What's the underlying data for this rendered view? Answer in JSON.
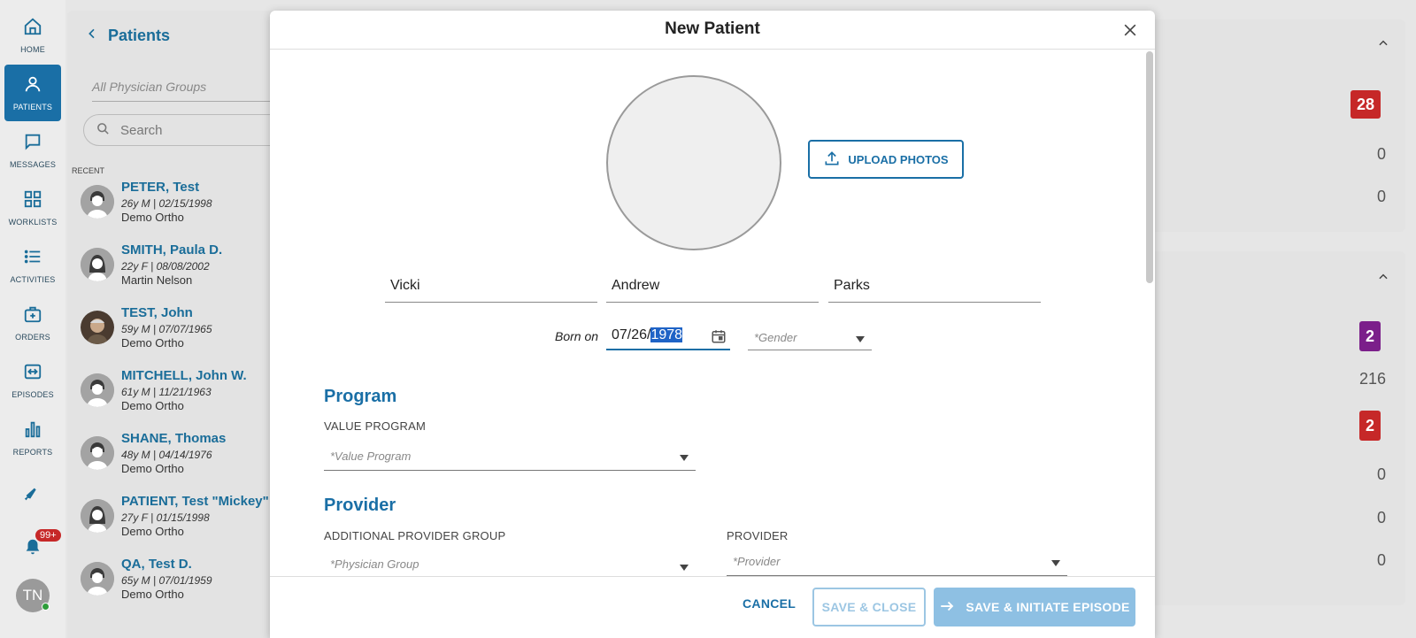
{
  "nav": {
    "items": [
      {
        "label": "HOME",
        "icon": "home-icon"
      },
      {
        "label": "PATIENTS",
        "icon": "person-icon"
      },
      {
        "label": "MESSAGES",
        "icon": "chat-icon"
      },
      {
        "label": "WORKLISTS",
        "icon": "grid-icon"
      },
      {
        "label": "ACTIVITIES",
        "icon": "list-icon"
      },
      {
        "label": "ORDERS",
        "icon": "medical-bag-icon"
      },
      {
        "label": "EPISODES",
        "icon": "episodes-icon"
      },
      {
        "label": "REPORTS",
        "icon": "bar-chart-icon"
      }
    ],
    "notifications_count": "99+",
    "user_initials": "TN"
  },
  "patients": {
    "title": "Patients",
    "filter_placeholder": "All Physician Groups",
    "search_placeholder": "Search",
    "recent_label": "RECENT",
    "list": [
      {
        "name": "PETER, Test",
        "meta": "26y M | 02/15/1998",
        "org": "Demo Ortho",
        "avatar": "male"
      },
      {
        "name": "SMITH, Paula D.",
        "meta": "22y F | 08/08/2002",
        "org": "Martin Nelson",
        "avatar": "female"
      },
      {
        "name": "TEST, John",
        "meta": "59y M | 07/07/1965",
        "org": "Demo Ortho",
        "avatar": "photo"
      },
      {
        "name": "MITCHELL, John W.",
        "meta": "61y M | 11/21/1963",
        "org": "Demo Ortho",
        "avatar": "male"
      },
      {
        "name": "SHANE, Thomas",
        "meta": "48y M | 04/14/1976",
        "org": "Demo Ortho",
        "avatar": "male"
      },
      {
        "name": "PATIENT, Test \"Mickey\"",
        "meta": "27y F | 01/15/1998",
        "org": "Demo Ortho",
        "avatar": "female"
      },
      {
        "name": "QA, Test D.",
        "meta": "65y M | 07/01/1959",
        "org": "Demo Ortho",
        "avatar": "male"
      }
    ]
  },
  "right_panel": {
    "card1_values": [
      "28",
      "0",
      "0"
    ],
    "card2_values": [
      "2",
      "216",
      "2",
      "0",
      "0",
      "0"
    ],
    "colors": {
      "red": "#c62828",
      "purple": "#7b1f8a"
    }
  },
  "modal": {
    "title": "New Patient",
    "upload_label": "UPLOAD PHOTOS",
    "first_name": "Vicki",
    "middle_name": "Andrew",
    "last_name": "Parks",
    "born_on_label": "Born on",
    "dob_prefix": "07/26/",
    "dob_selected": "1978",
    "gender_placeholder": "*Gender",
    "program_heading": "Program",
    "value_program_label": "VALUE PROGRAM",
    "value_program_placeholder": "*Value Program",
    "provider_heading": "Provider",
    "additional_group_label": "ADDITIONAL PROVIDER GROUP",
    "physician_group_placeholder": "*Physician Group",
    "provider_label": "PROVIDER",
    "provider_placeholder": "*Provider",
    "cancel_label": "CANCEL",
    "save_close_label": "SAVE & CLOSE",
    "save_initiate_label": "SAVE & INITIATE EPISODE"
  },
  "colors": {
    "accent": "#1a6fa6",
    "accent_disabled": "#8ec0e3"
  }
}
